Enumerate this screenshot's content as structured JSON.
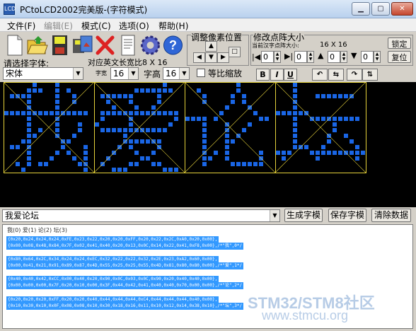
{
  "window": {
    "title": "PCtoLCD2002完美版-(字符模式)"
  },
  "menu": [
    {
      "label": "文件(F)",
      "enabled": true
    },
    {
      "label": "编辑(E)",
      "enabled": false
    },
    {
      "label": "模式(C)",
      "enabled": true
    },
    {
      "label": "选项(O)",
      "enabled": true
    },
    {
      "label": "帮助(H)",
      "enabled": true
    }
  ],
  "toolbar": {
    "icons": [
      "new-icon",
      "open-icon",
      "save-icon",
      "save-image-icon",
      "delete-icon",
      "document-icon",
      "gear-icon",
      "help-icon"
    ],
    "select_font_label": "请选择字体:",
    "font_value": "宋体",
    "en_ratio_label": "对应英文长宽比8 X 16",
    "width_label": "字宽",
    "width_value": "16",
    "height_label": "字高",
    "height_value": "16",
    "proportional_label": "等比缩放",
    "pixel_pos_label": "调整像素位置",
    "dot_size_label": "修改点阵大小",
    "current_size_label": "当前汉字点阵大小:",
    "current_size_value": "16 X 16",
    "lock_label": "锁定",
    "reset_label": "复位",
    "spin_values": [
      "0",
      "0",
      "0",
      "0"
    ],
    "bold_label": "B",
    "italic_label": "I",
    "underline_label": "U"
  },
  "input": {
    "text": "我爱论坛"
  },
  "actions": {
    "generate": "生成字模",
    "save": "保存字模",
    "clear": "清除数据"
  },
  "output": {
    "header": "我(0) 爱(1) 论(2) 坛(3)",
    "lines": [
      "{0x20,0x24,0x24,0x24,0xFE,0x23,0x22,0x20,0x20,0xFF,0x20,0x22,0x2C,0xA0,0x20,0x00},",
      "{0x00,0x08,0x48,0x84,0x7F,0x02,0x41,0x40,0x20,0x13,0x0C,0x14,0x22,0x41,0xF8,0x00},/*\"我\",0*/",
      "{0x80,0x64,0x2C,0x34,0x24,0x24,0xEC,0x32,0x22,0x22,0x32,0x2E,0x23,0xA2,0x60,0x00},",
      "{0x00,0x41,0x21,0x91,0x89,0x87,0x4D,0x55,0x25,0x25,0x55,0x4D,0x81,0x80,0x80,0x00},/*\"爱\",1*/",
      "{0x40,0x40,0x42,0xCC,0x00,0x40,0x20,0x90,0x0C,0x03,0x0C,0x90,0x20,0x40,0x40,0x00},",
      "{0x00,0x00,0x00,0x7F,0x20,0x10,0x00,0x3F,0x44,0x42,0x41,0x40,0x40,0x70,0x00,0x00},/*\"论\",2*/",
      "{0x20,0x20,0x20,0xFF,0x20,0x20,0x40,0x44,0x44,0x44,0xC4,0x44,0x44,0x44,0x40,0x00},",
      "{0x10,0x30,0x10,0x0F,0x08,0x08,0x10,0x30,0x18,0x16,0x11,0x10,0x12,0x14,0x38,0x10},/*\"坛\",3*/"
    ]
  },
  "watermark": {
    "brand": "STM32/STM8社区",
    "url": "www.stmcu.org"
  },
  "colors": {
    "pixel": "#1a66e6",
    "grid": "#e6d23a",
    "background": "#000000",
    "selection": "#3399ff"
  }
}
